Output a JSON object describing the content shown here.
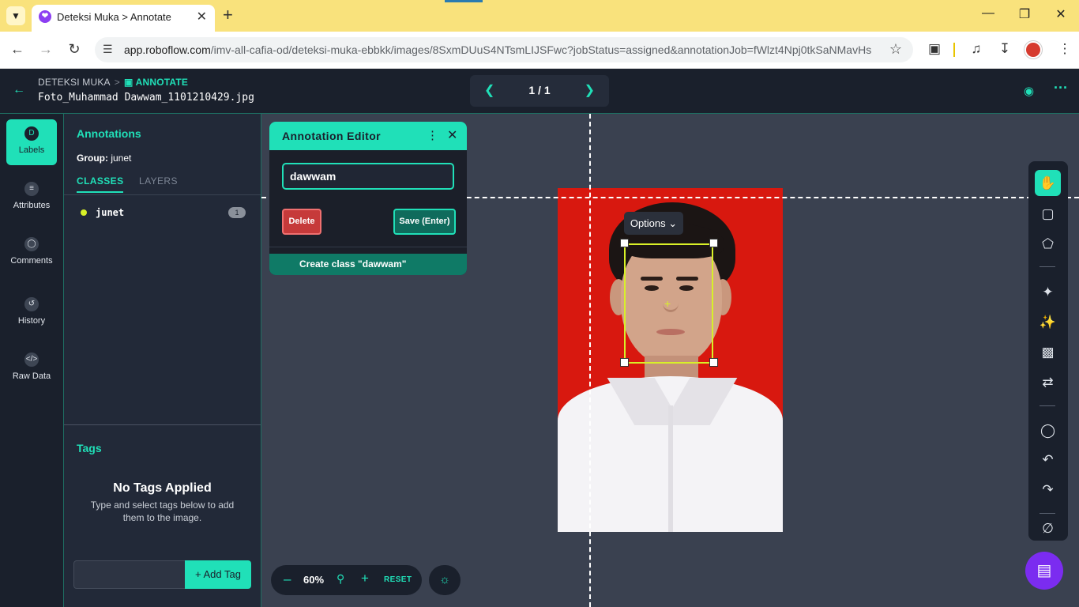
{
  "browser": {
    "tab_title": "Deteksi Muka > Annotate",
    "favicon": "roboflow-logo",
    "url_host": "app.roboflow.com",
    "url_path": "/imv-all-cafia-od/deteksi-muka-ebbkk/images/8SxmDUuS4NTsmLIJSFwc?jobStatus=assigned&annotationJob=fWlzt4Npj0tkSaNMavHs"
  },
  "header": {
    "breadcrumb_project": "DETEKSI MUKA",
    "breadcrumb_sep": ">",
    "breadcrumb_current": "ANNOTATE",
    "file_name": "Foto_Muhammad Dawwam_1101210429.jpg",
    "pager": "1 / 1"
  },
  "rail": {
    "items": [
      {
        "label": "Labels",
        "icon": "labels-icon"
      },
      {
        "label": "Attributes",
        "icon": "list-icon"
      },
      {
        "label": "Comments",
        "icon": "comment-icon"
      },
      {
        "label": "History",
        "icon": "history-icon"
      },
      {
        "label": "Raw Data",
        "icon": "code-icon"
      }
    ]
  },
  "panel": {
    "title": "Annotations",
    "group_label": "Group:",
    "group_value": "junet",
    "tabs": [
      "CLASSES",
      "LAYERS"
    ],
    "classes": [
      {
        "name": "junet",
        "count": "1",
        "color": "#d8f028"
      }
    ],
    "tags_title": "Tags",
    "no_tags_title": "No Tags Applied",
    "no_tags_sub": "Type and select tags below to add them to the image.",
    "add_tag_label": "+ Add Tag"
  },
  "editor": {
    "title": "Annotation Editor",
    "input_value": "dawwam",
    "delete_label": "Delete",
    "save_label": "Save (Enter)",
    "create_label": "Create class \"dawwam\""
  },
  "canvas": {
    "options_label": "Options",
    "zoom": "60%",
    "reset_label": "RESET"
  },
  "colors": {
    "accent": "#20e0b8",
    "background": "#1a202c",
    "bbox": "#d8f028"
  }
}
